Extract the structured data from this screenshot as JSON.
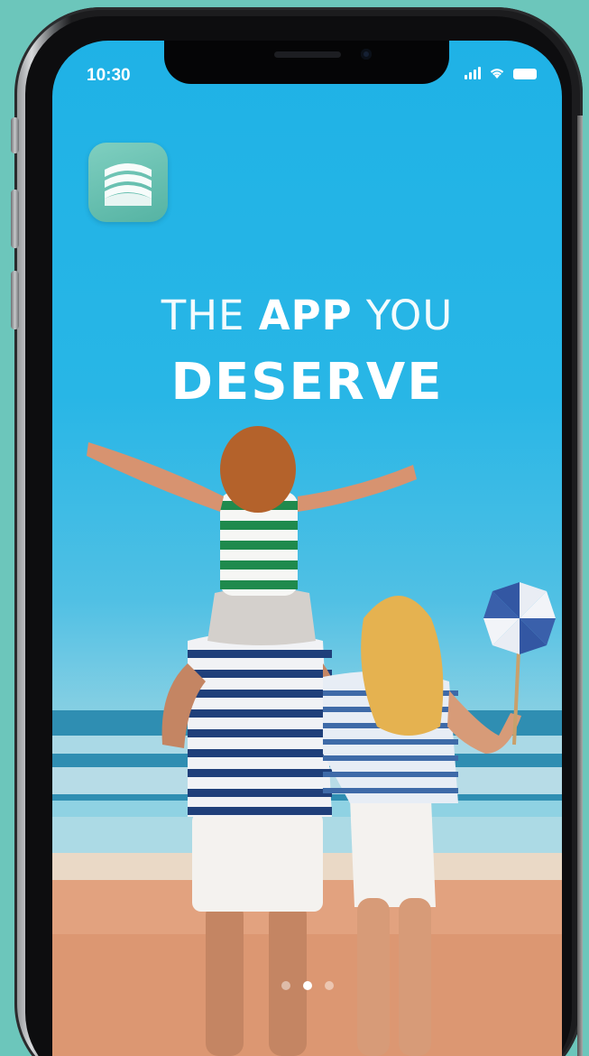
{
  "status_bar": {
    "time": "10:30"
  },
  "app": {
    "logo_icon": "layered-waves-logo",
    "headline_line1": {
      "part1": "THE ",
      "part2": "APP",
      "part3": " YOU"
    },
    "headline_line2": "DESERVE"
  },
  "carousel": {
    "page_count": 3,
    "active_index": 1
  },
  "colors": {
    "background": "#6cc6bb",
    "sky": "#28b6e6",
    "logo": "#6cc4b4"
  }
}
